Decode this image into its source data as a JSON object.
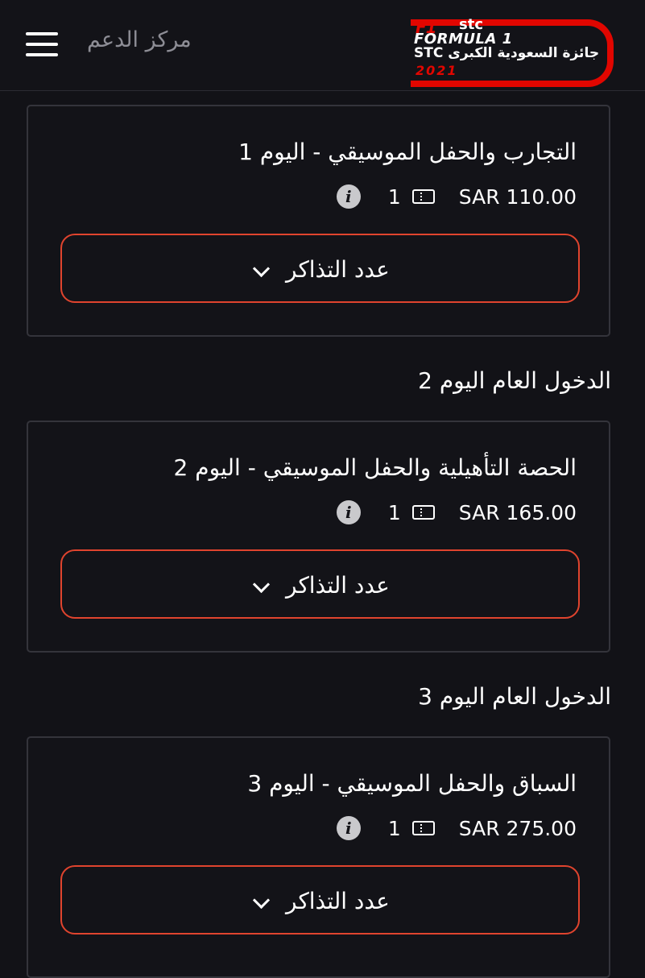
{
  "header": {
    "menu_icon": "hamburger-icon",
    "support_label": "مركز الدعم",
    "logo": {
      "f1": "F1",
      "stc": "stc",
      "formula": "FORMULA 1",
      "arabic": "STC جائزة السعودية الكبرى",
      "year": "2021",
      "accent_color": "#e10600"
    }
  },
  "accent_color": "#e0442e",
  "tickets": [
    {
      "section_heading": "",
      "title": "التجارب والحفل الموسيقي - اليوم 1",
      "price": "SAR 110.00",
      "quantity": "1",
      "select_label": "عدد التذاكر"
    },
    {
      "section_heading": "الدخول العام اليوم 2",
      "title": "الحصة التأهيلية والحفل الموسيقي - اليوم 2",
      "price": "SAR 165.00",
      "quantity": "1",
      "select_label": "عدد التذاكر"
    },
    {
      "section_heading": "الدخول العام اليوم 3",
      "title": "السباق والحفل الموسيقي - اليوم 3",
      "price": "SAR 275.00",
      "quantity": "1",
      "select_label": "عدد التذاكر"
    }
  ]
}
